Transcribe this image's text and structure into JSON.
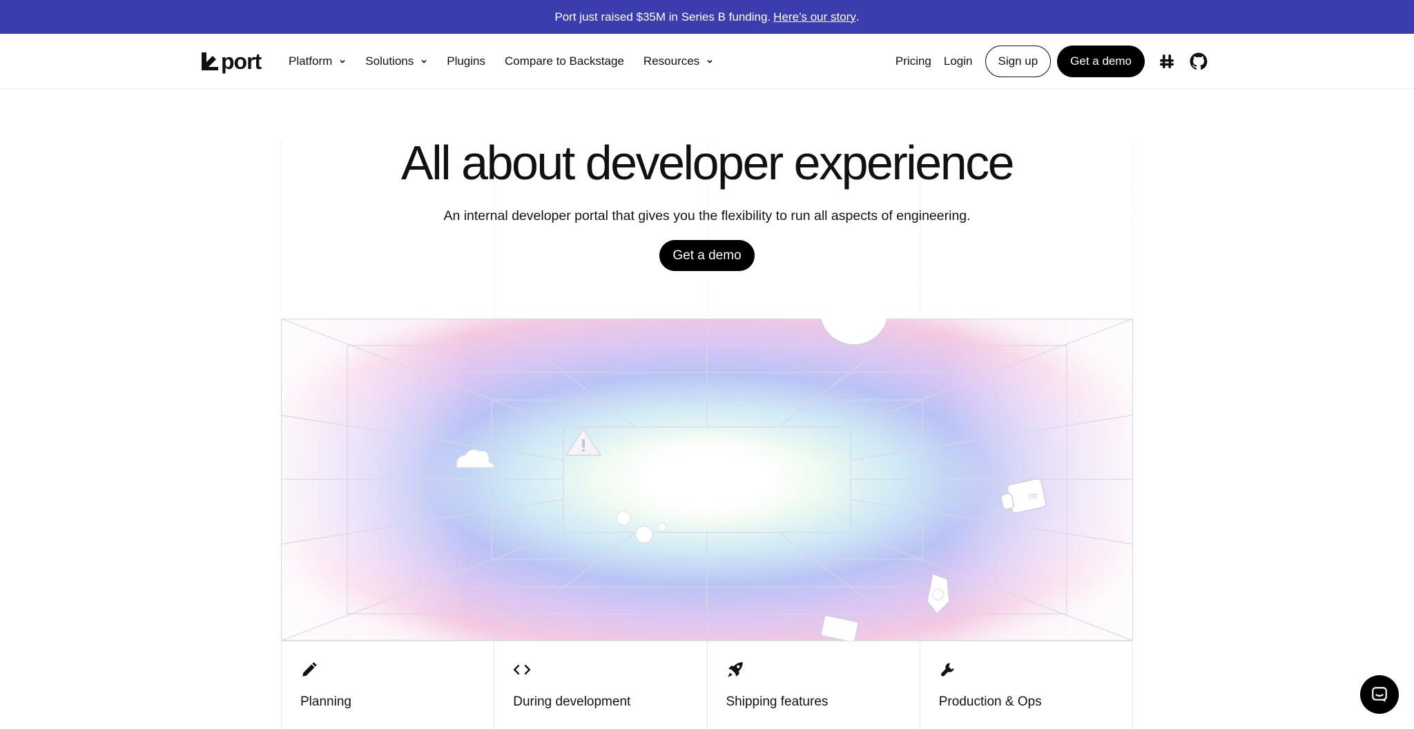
{
  "announcement": {
    "text": "Port just raised $35M in Series B funding.",
    "link": "Here’s our story",
    "suffix": "."
  },
  "nav": {
    "logo": "port",
    "items": [
      {
        "label": "Platform",
        "dropdown": true
      },
      {
        "label": "Solutions",
        "dropdown": true
      },
      {
        "label": "Plugins",
        "dropdown": false
      },
      {
        "label": "Compare to Backstage",
        "dropdown": false
      },
      {
        "label": "Resources",
        "dropdown": true
      }
    ],
    "pricing": "Pricing",
    "login": "Login",
    "signup": "Sign up",
    "demo": "Get a demo",
    "icons": [
      "slack-icon",
      "github-icon"
    ]
  },
  "hero": {
    "title": "All about developer experience",
    "subtitle": "An internal developer portal that gives you the flexibility to run all aspects of engineering.",
    "cta": "Get a demo"
  },
  "cards": [
    {
      "icon": "pencil-icon",
      "title": "Planning"
    },
    {
      "icon": "code-icon",
      "title": "During development"
    },
    {
      "icon": "rocket-icon",
      "title": "Shipping features"
    },
    {
      "icon": "wrench-icon",
      "title": "Production & Ops"
    }
  ],
  "colors": {
    "announce_bg": "#3b3cad",
    "primary_button": "#000000"
  }
}
